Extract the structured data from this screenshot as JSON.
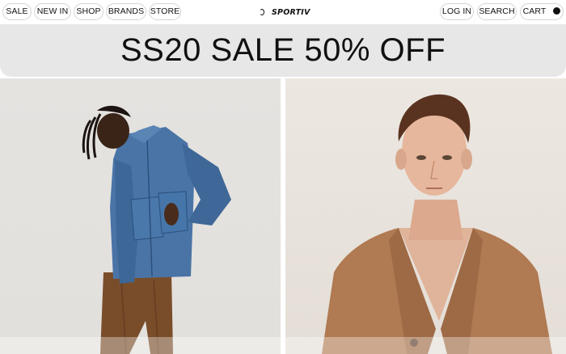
{
  "nav": {
    "left_items": [
      {
        "label": "SALE"
      },
      {
        "label": "NEW IN"
      },
      {
        "label": "SHOP"
      },
      {
        "label": "BRANDS"
      },
      {
        "label": "STORE"
      }
    ],
    "logo_text": "SPORTIV",
    "right_items": [
      {
        "label": "LOG IN"
      },
      {
        "label": "SEARCH"
      },
      {
        "label": "CART"
      }
    ]
  },
  "banner": {
    "text": "SS20 SALE 50% OFF"
  },
  "products": [
    {
      "image": "man-in-denim-jacket-photo"
    },
    {
      "image": "man-in-tan-cardigan-photo"
    }
  ]
}
